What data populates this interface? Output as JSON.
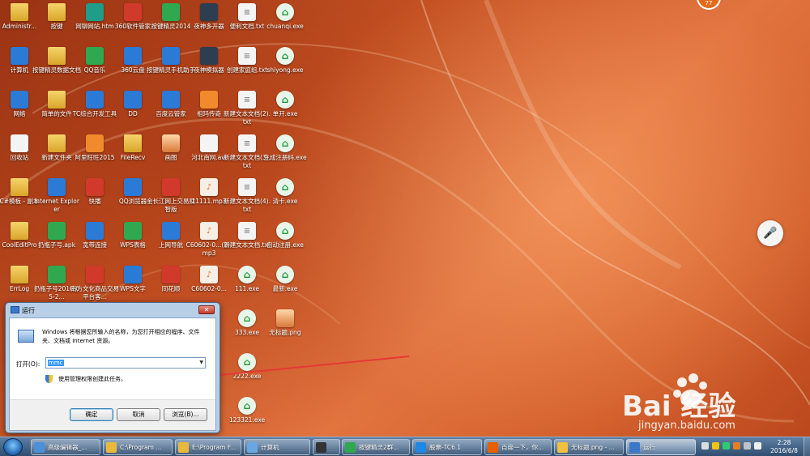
{
  "desktop_icons": [
    {
      "label": "Administr...",
      "icon": "user-folder-icon"
    },
    {
      "label": "按键",
      "icon": "folder-icon"
    },
    {
      "label": "网聊网站.htm",
      "icon": "html-file-icon"
    },
    {
      "label": "360软件管家",
      "icon": "app-360-softmgr-icon"
    },
    {
      "label": "按键精灵2014",
      "icon": "anjian-app-icon"
    },
    {
      "label": "夜神多开器",
      "icon": "nox-multi-icon"
    },
    {
      "label": "便利文档.txt",
      "icon": "text-file-icon"
    },
    {
      "label": "chuanqi.exe",
      "icon": "exe-house-icon"
    },
    {
      "label": "计算机",
      "icon": "computer-icon"
    },
    {
      "label": "按键精灵数据文档",
      "icon": "folder-icon"
    },
    {
      "label": "QQ音乐",
      "icon": "qq-music-icon"
    },
    {
      "label": "360云盘",
      "icon": "cloud-disk-icon"
    },
    {
      "label": "按键精灵手机助手",
      "icon": "anjian-phone-icon"
    },
    {
      "label": "夜神模拟器",
      "icon": "nox-icon"
    },
    {
      "label": "创建家庭组.txt",
      "icon": "text-file-icon"
    },
    {
      "label": "shiyong.exe",
      "icon": "exe-house-icon"
    },
    {
      "label": "网络",
      "icon": "network-icon"
    },
    {
      "label": "简单的文件",
      "icon": "folder-icon"
    },
    {
      "label": "TC综合开发工具",
      "icon": "tc-dev-icon"
    },
    {
      "label": "DD",
      "icon": "dd-icon"
    },
    {
      "label": "百度云管家",
      "icon": "baidu-cloud-icon"
    },
    {
      "label": "祖玛传奇",
      "icon": "game-icon"
    },
    {
      "label": "新建文本文档(2).txt",
      "icon": "text-file-icon"
    },
    {
      "label": "单开.exe",
      "icon": "exe-house-icon"
    },
    {
      "label": "回收站",
      "icon": "recycle-bin-icon"
    },
    {
      "label": "新建文件夹",
      "icon": "folder-icon"
    },
    {
      "label": "阿里旺旺2015",
      "icon": "aliwangwang-icon"
    },
    {
      "label": "FileRecv",
      "icon": "folder-icon"
    },
    {
      "label": "画图",
      "icon": "paint-icon"
    },
    {
      "label": "河北南网.avi",
      "icon": "video-file-icon"
    },
    {
      "label": "新建文本文档(3).txt",
      "icon": "text-file-icon"
    },
    {
      "label": "生成注册码.exe",
      "icon": "exe-house-icon"
    },
    {
      "label": "C#模板 - 副本",
      "icon": "folder-icon"
    },
    {
      "label": "Internet Explorer",
      "icon": "ie-icon"
    },
    {
      "label": "快播",
      "icon": "qvod-icon"
    },
    {
      "label": "QQ浏览器",
      "icon": "qq-browser-icon"
    },
    {
      "label": "金长江网上交易财智版",
      "icon": "trading-app-icon"
    },
    {
      "label": "11111.mp3",
      "icon": "audio-file-icon"
    },
    {
      "label": "新建文本文档(4).txt",
      "icon": "text-file-icon"
    },
    {
      "label": "清卡.exe",
      "icon": "exe-house-icon"
    },
    {
      "label": "CoolEditPro",
      "icon": "folder-icon"
    },
    {
      "label": "扔瓶子号.apk",
      "icon": "apk-icon"
    },
    {
      "label": "宽带连接",
      "icon": "broadband-icon"
    },
    {
      "label": "WPS表格",
      "icon": "wps-sheet-icon"
    },
    {
      "label": "上网导航",
      "icon": "web-nav-icon"
    },
    {
      "label": "C60602-0...(2).mp3",
      "icon": "audio-file-icon"
    },
    {
      "label": "新建文本文档.txt",
      "icon": "text-file-icon"
    },
    {
      "label": "自动注册.exe",
      "icon": "exe-house-icon"
    },
    {
      "label": "ErrLog",
      "icon": "folder-icon"
    },
    {
      "label": "扔瓶子号2016-05-2...",
      "icon": "apk-icon"
    },
    {
      "label": "南方文化商品交易平台客...",
      "icon": "trading-app-icon"
    },
    {
      "label": "WPS文字",
      "icon": "wps-writer-icon"
    },
    {
      "label": "同花顺",
      "icon": "tonghuashun-icon"
    },
    {
      "label": "C60602-0...",
      "icon": "audio-file-icon"
    },
    {
      "label": "111.exe",
      "icon": "exe-house-icon"
    },
    {
      "label": "最新.exe",
      "icon": "exe-house-icon"
    },
    {
      "label": "333.exe",
      "icon": "exe-house-icon"
    },
    {
      "label": "无标题.png",
      "icon": "image-file-icon"
    },
    {
      "label": "2222.exe",
      "icon": "exe-house-icon"
    },
    {
      "label": "123321.exe",
      "icon": "exe-house-icon"
    }
  ],
  "run_dialog": {
    "title": "运行",
    "close": "✕",
    "description": "Windows 将根据您所输入的名称，为您打开相应的程序、文件夹、文档或 Internet 资源。",
    "open_label": "打开(O):",
    "input_value": "mmc",
    "admin_note": "使用管理权限创建此任务。",
    "ok": "确定",
    "cancel": "取消",
    "browse": "浏览(B)..."
  },
  "taskbar": {
    "items": [
      {
        "label": "高级编辑器_...",
        "icon": "browser-icon",
        "color": "#4a90d9"
      },
      {
        "label": "C:\\Program ...",
        "icon": "folder-icon",
        "color": "#e8b93c"
      },
      {
        "label": "E:\\Program F...",
        "icon": "folder-icon",
        "color": "#e8b93c"
      },
      {
        "label": "计算机",
        "icon": "computer-icon",
        "color": "#6aa6e0"
      },
      {
        "label": "",
        "icon": "nox-icon",
        "color": "#333333"
      },
      {
        "label": "按键精灵2群...",
        "icon": "anjian-app-icon",
        "color": "#2fa84f"
      },
      {
        "label": "股票-TC6.1",
        "icon": "tc-dev-icon",
        "color": "#1e88e5"
      },
      {
        "label": "百度一下，你...",
        "icon": "firefox-icon",
        "color": "#e66000"
      },
      {
        "label": "无标题.png - ...",
        "icon": "paint-icon",
        "color": "#f0c040"
      },
      {
        "label": "运行",
        "icon": "run-icon",
        "color": "#3b78c9"
      }
    ],
    "clock_time": "2:28",
    "clock_date": "2016/6/8"
  },
  "overlay": {
    "notify_count": "77",
    "watermark_logo": "Bai  经验",
    "watermark_url": "jingyan.baidu.com"
  }
}
